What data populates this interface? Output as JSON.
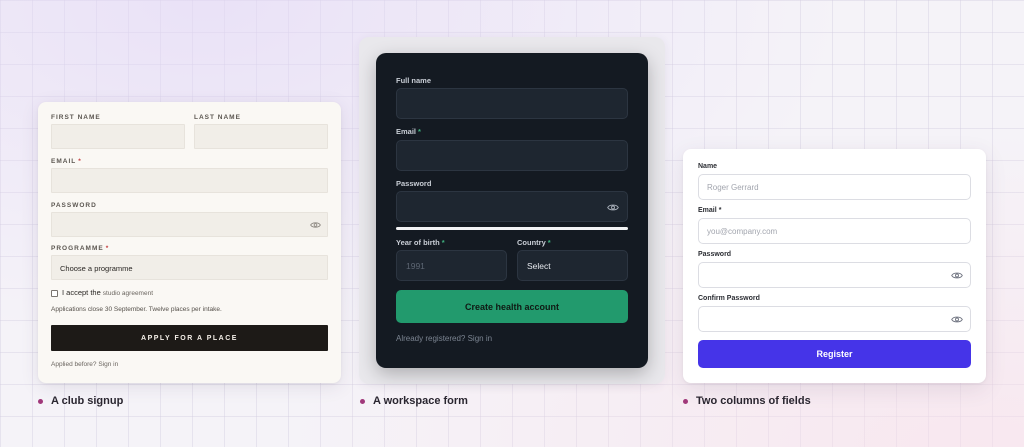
{
  "club_signup": {
    "first_name_label": "FIRST NAME",
    "last_name_label": "LAST NAME",
    "email_label": "EMAIL",
    "password_label": "PASSWORD",
    "programme_label": "PROGRAMME",
    "required_mark": "*",
    "programme_value": "Choose a programme",
    "accept_text": "I accept the",
    "accept_link": "studio agreement",
    "applications_note": "Applications close 30 September. Twelve places per intake.",
    "apply_button": "APPLY FOR A PLACE",
    "signin_text": "Applied before? Sign in"
  },
  "workspace_form": {
    "full_name_label": "Full name",
    "email_label": "Email",
    "password_label": "Password",
    "year_label": "Year of birth",
    "country_label": "Country",
    "required_mark": "*",
    "year_placeholder": "1991",
    "country_value": "Select",
    "create_button": "Create health account",
    "signin_text": "Already registered? Sign in"
  },
  "two_columns": {
    "name_label": "Name",
    "name_placeholder": "Roger Gerrard",
    "email_label": "Email",
    "email_placeholder": "you@company.com",
    "password_label": "Password",
    "confirm_label": "Confirm Password",
    "required_mark": "*",
    "register_button": "Register"
  },
  "captions": {
    "card1": "A club signup",
    "card2": "A workspace form",
    "card3": "Two columns of fields"
  },
  "colors": {
    "club_button": "#1d1a17",
    "workspace_bg": "#141a22",
    "workspace_button": "#229a6d",
    "register_button": "#4534e8",
    "caption_dot": "#a0387a"
  }
}
